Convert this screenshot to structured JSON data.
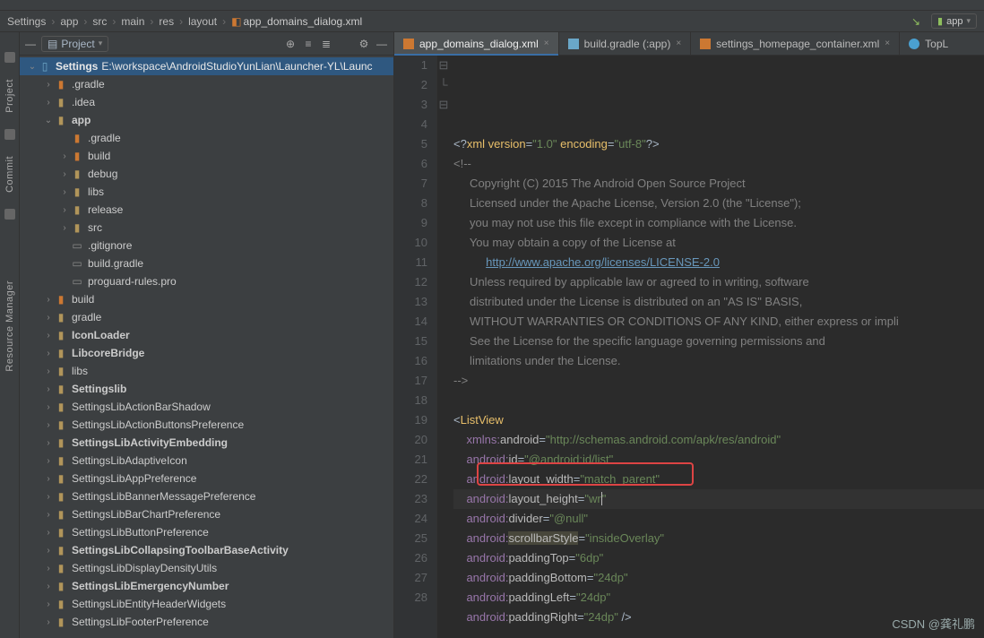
{
  "breadcrumb": {
    "items": [
      "Settings",
      "app",
      "src",
      "main",
      "res",
      "layout"
    ],
    "file": "app_domains_dialog.xml",
    "run_target": "app"
  },
  "project_panel": {
    "title": "Project",
    "root": {
      "name": "Settings",
      "path": "E:\\workspace\\AndroidStudioYunLian\\Launcher-YL\\Launc"
    }
  },
  "left_rail": {
    "labels": [
      "Project",
      "Commit",
      "Resource Manager"
    ]
  },
  "tree": [
    {
      "depth": 0,
      "arrow": "v",
      "icon": "folder-blue",
      "label": "Settings",
      "detail": "E:\\workspace\\AndroidStudioYunLian\\Launcher-YL\\Launc",
      "bold": true,
      "selected": true
    },
    {
      "depth": 1,
      "arrow": ">",
      "icon": "folder-orange",
      "label": ".gradle",
      "color": "folder-orange"
    },
    {
      "depth": 1,
      "arrow": ">",
      "icon": "folder-yellow",
      "label": ".idea"
    },
    {
      "depth": 1,
      "arrow": "v",
      "icon": "folder-yellow",
      "label": "app",
      "bold": true
    },
    {
      "depth": 2,
      "arrow": "",
      "icon": "folder-orange",
      "label": ".gradle",
      "color": "folder-grey"
    },
    {
      "depth": 2,
      "arrow": ">",
      "icon": "folder-orange",
      "label": "build",
      "color": "folder-orange"
    },
    {
      "depth": 2,
      "arrow": ">",
      "icon": "folder-yellow",
      "label": "debug"
    },
    {
      "depth": 2,
      "arrow": ">",
      "icon": "folder-yellow",
      "label": "libs"
    },
    {
      "depth": 2,
      "arrow": ">",
      "icon": "folder-yellow",
      "label": "release"
    },
    {
      "depth": 2,
      "arrow": ">",
      "icon": "folder-yellow",
      "label": "src"
    },
    {
      "depth": 2,
      "arrow": "",
      "icon": "file-grey",
      "label": ".gitignore"
    },
    {
      "depth": 2,
      "arrow": "",
      "icon": "file-grey",
      "label": "build.gradle"
    },
    {
      "depth": 2,
      "arrow": "",
      "icon": "file-grey",
      "label": "proguard-rules.pro"
    },
    {
      "depth": 1,
      "arrow": ">",
      "icon": "folder-orange",
      "label": "build",
      "color": "folder-orange"
    },
    {
      "depth": 1,
      "arrow": ">",
      "icon": "folder-yellow",
      "label": "gradle"
    },
    {
      "depth": 1,
      "arrow": ">",
      "icon": "folder-yellow",
      "label": "IconLoader",
      "bold": true
    },
    {
      "depth": 1,
      "arrow": ">",
      "icon": "folder-yellow",
      "label": "LibcoreBridge",
      "bold": true
    },
    {
      "depth": 1,
      "arrow": ">",
      "icon": "folder-yellow",
      "label": "libs"
    },
    {
      "depth": 1,
      "arrow": ">",
      "icon": "folder-yellow",
      "label": "Settingslib",
      "bold": true
    },
    {
      "depth": 1,
      "arrow": ">",
      "icon": "folder-yellow",
      "label": "SettingsLibActionBarShadow"
    },
    {
      "depth": 1,
      "arrow": ">",
      "icon": "folder-yellow",
      "label": "SettingsLibActionButtonsPreference"
    },
    {
      "depth": 1,
      "arrow": ">",
      "icon": "folder-yellow",
      "label": "SettingsLibActivityEmbedding",
      "bold": true
    },
    {
      "depth": 1,
      "arrow": ">",
      "icon": "folder-yellow",
      "label": "SettingsLibAdaptiveIcon"
    },
    {
      "depth": 1,
      "arrow": ">",
      "icon": "folder-yellow",
      "label": "SettingsLibAppPreference"
    },
    {
      "depth": 1,
      "arrow": ">",
      "icon": "folder-yellow",
      "label": "SettingsLibBannerMessagePreference"
    },
    {
      "depth": 1,
      "arrow": ">",
      "icon": "folder-yellow",
      "label": "SettingsLibBarChartPreference"
    },
    {
      "depth": 1,
      "arrow": ">",
      "icon": "folder-yellow",
      "label": "SettingsLibButtonPreference"
    },
    {
      "depth": 1,
      "arrow": ">",
      "icon": "folder-yellow",
      "label": "SettingsLibCollapsingToolbarBaseActivity",
      "bold": true
    },
    {
      "depth": 1,
      "arrow": ">",
      "icon": "folder-yellow",
      "label": "SettingsLibDisplayDensityUtils"
    },
    {
      "depth": 1,
      "arrow": ">",
      "icon": "folder-yellow",
      "label": "SettingsLibEmergencyNumber",
      "bold": true
    },
    {
      "depth": 1,
      "arrow": ">",
      "icon": "folder-yellow",
      "label": "SettingsLibEntityHeaderWidgets"
    },
    {
      "depth": 1,
      "arrow": ">",
      "icon": "folder-yellow",
      "label": "SettingsLibFooterPreference"
    }
  ],
  "tabs": [
    {
      "label": "app_domains_dialog.xml",
      "active": true,
      "icon": "xml"
    },
    {
      "label": "build.gradle (:app)",
      "active": false,
      "icon": "gradle"
    },
    {
      "label": "settings_homepage_container.xml",
      "active": false,
      "icon": "xml"
    },
    {
      "label": "TopL",
      "active": false,
      "icon": "kt"
    }
  ],
  "code": {
    "lines": [
      1,
      2,
      3,
      4,
      5,
      6,
      7,
      8,
      9,
      10,
      11,
      12,
      13,
      14,
      15,
      16,
      17,
      18,
      19,
      20,
      21,
      22,
      23,
      24,
      25,
      26,
      27,
      28
    ],
    "xml_pi_version": "1.0",
    "xml_pi_encoding": "utf-8",
    "comment_lines": [
      "",
      "     Copyright (C) 2015 The Android Open Source Project",
      "",
      "     Licensed under the Apache License, Version 2.0 (the \"License\");",
      "     you may not use this file except in compliance with the License.",
      "     You may obtain a copy of the License at",
      "",
      "          ",
      "",
      "     Unless required by applicable law or agreed to in writing, software",
      "     distributed under the License is distributed on an \"AS IS\" BASIS,",
      "     WITHOUT WARRANTIES OR CONDITIONS OF ANY KIND, either express or impli",
      "     See the License for the specific language governing permissions and",
      "     limitations under the License."
    ],
    "license_url": "http://www.apache.org/licenses/LICENSE-2.0",
    "tag": "ListView",
    "attrs": {
      "xmlns_android": "http://schemas.android.com/apk/res/android",
      "id": "@android:id/list",
      "layout_width": "match_parent",
      "layout_height": "wr",
      "divider": "@null",
      "scrollbarStyle": "insideOverlay",
      "paddingTop": "6dp",
      "paddingBottom": "24dp",
      "paddingLeft": "24dp",
      "paddingRight": "24dp"
    }
  },
  "watermark": "CSDN @龚礼鹏"
}
